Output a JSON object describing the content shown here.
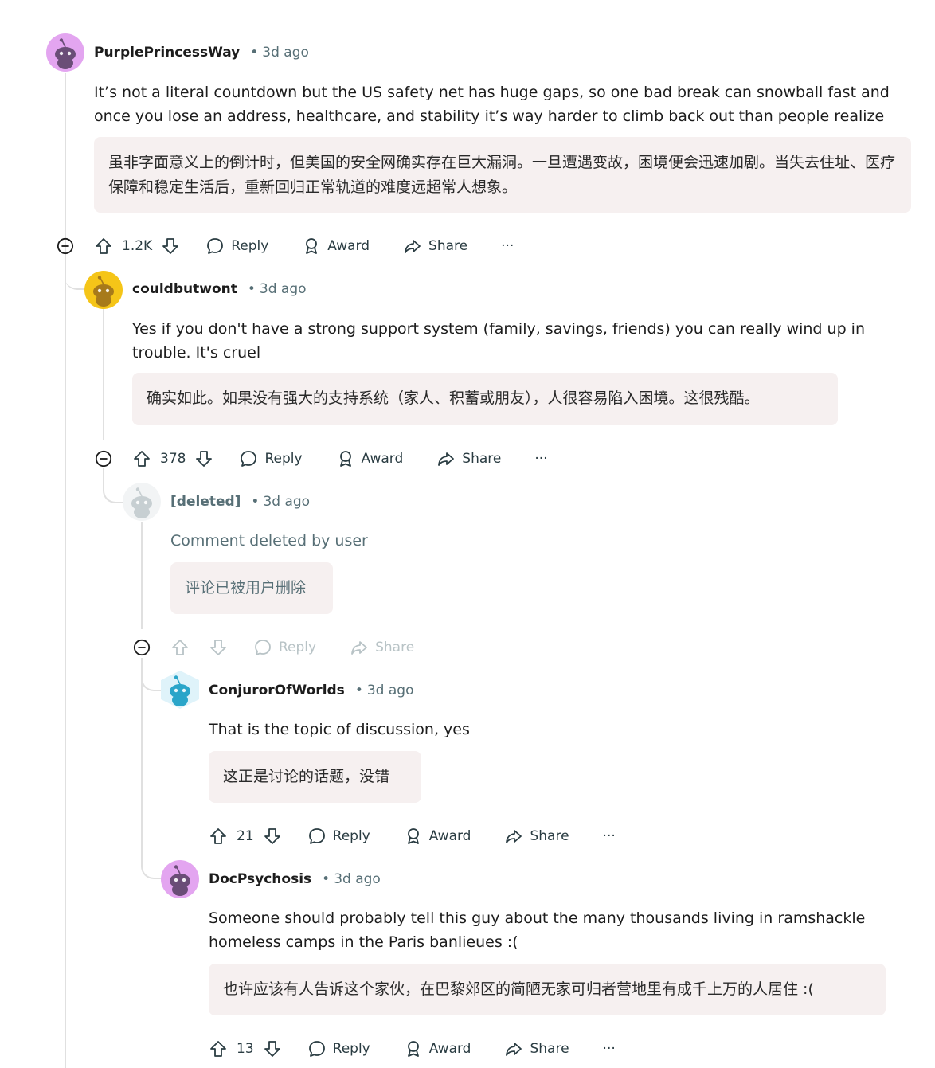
{
  "comments": [
    {
      "author": "PurplePrincessWay",
      "dot": "•",
      "time": "3d ago",
      "body": "It’s not a literal countdown but the US safety net has huge gaps, so one bad break can snowball fast and once you lose an address, healthcare, and stability it’s way harder to climb back out than people realize",
      "translation": "虽非字面意义上的倒计时，但美国的安全网确实存在巨大漏洞。一旦遭遇变故，困境便会迅速加剧。当失去住址、医疗保障和稳定生活后，重新回归正常轨道的难度远超常人想象。",
      "votes": "1.2K",
      "reply": "Reply",
      "award": "Award",
      "share": "Share",
      "more": "···",
      "avatar_color": "#e3a5f0"
    },
    {
      "author": "couldbutwont",
      "dot": "•",
      "time": "3d ago",
      "body": "Yes if you don't have a strong support system (family, savings, friends) you can really wind up in trouble. It's cruel",
      "translation": "确实如此。如果没有强大的支持系统（家人、积蓄或朋友），人很容易陷入困境。这很残酷。",
      "votes": "378",
      "reply": "Reply",
      "award": "Award",
      "share": "Share",
      "more": "···",
      "avatar_color": "#f5c518"
    },
    {
      "author": "[deleted]",
      "dot": "•",
      "time": "3d ago",
      "body": "Comment deleted by user",
      "translation": "评论已被用户删除",
      "reply": "Reply",
      "share": "Share"
    },
    {
      "author": "ConjurorOfWorlds",
      "dot": "•",
      "time": "3d ago",
      "body": "That is the topic of discussion, yes",
      "translation": "这正是讨论的话题，没错",
      "votes": "21",
      "reply": "Reply",
      "award": "Award",
      "share": "Share",
      "more": "···",
      "avatar_color": "#2aa5c9"
    },
    {
      "author": "DocPsychosis",
      "dot": "•",
      "time": "3d ago",
      "body": "Someone should probably tell this guy about the many thousands living in ramshackle homeless camps in the Paris banlieues :(",
      "translation": "也许应该有人告诉这个家伙，在巴黎郊区的简陋无家可归者营地里有成千上万的人居住 :(",
      "votes": "13",
      "reply": "Reply",
      "award": "Award",
      "share": "Share",
      "more": "···",
      "avatar_color": "#e3a5f0"
    }
  ],
  "colors": {
    "text": "#1c1c1c",
    "muted": "#576f76",
    "translation_bg": "#f6f0f0",
    "thread_line": "#e0e0e0"
  }
}
